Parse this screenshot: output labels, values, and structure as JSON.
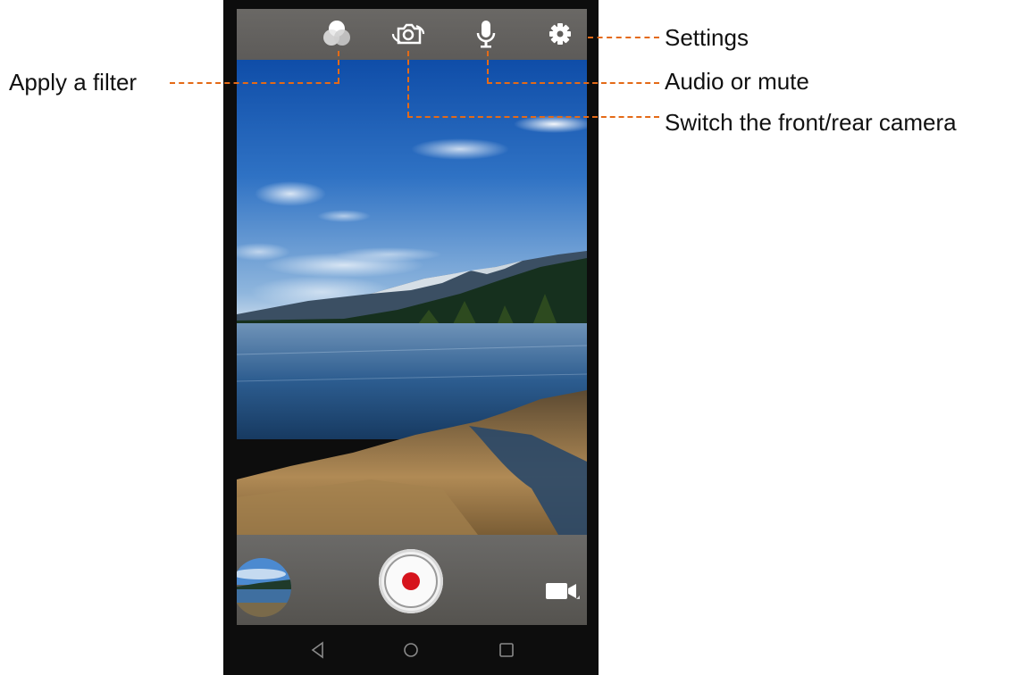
{
  "annotations": {
    "settings": "Settings",
    "filter": "Apply a filter",
    "audio": "Audio or mute",
    "switch_camera": "Switch the front/rear camera"
  },
  "toolbar": {
    "icons": [
      "filter-icon",
      "switch-camera-icon",
      "microphone-icon",
      "gear-icon"
    ]
  },
  "bottom": {
    "icons": [
      "gallery-thumbnail",
      "record-button",
      "video-camera-icon"
    ]
  },
  "navigation": {
    "icons": [
      "back-icon",
      "home-icon",
      "recents-icon"
    ]
  },
  "colors": {
    "accent_callout": "#e46a17",
    "record_dot": "#d6141d",
    "toolbar_bg": "#605e5b"
  }
}
